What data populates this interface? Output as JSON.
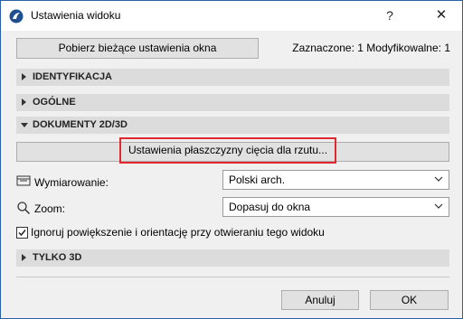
{
  "window": {
    "title": "Ustawienia widoku",
    "help_glyph": "?",
    "close_glyph": "✕"
  },
  "toolbar": {
    "fetch_label": "Pobierz bieżące ustawienia okna",
    "selection_info": "Zaznaczone: 1 Modyfikowalne: 1"
  },
  "sections": [
    {
      "label": "IDENTYFIKACJA",
      "expanded": false
    },
    {
      "label": "OGÓLNE",
      "expanded": false
    },
    {
      "label": "DOKUMENTY 2D/3D",
      "expanded": true
    },
    {
      "label": "TYLKO 3D",
      "expanded": false
    }
  ],
  "docs": {
    "cut_plane_label": "Ustawienia płaszczyzny cięcia dla rzutu...",
    "dimensioning_label": "Wymiarowanie:",
    "dimensioning_value": "Polski arch.",
    "zoom_label": "Zoom:",
    "zoom_value": "Dopasuj do okna",
    "ignore_zoom_label": "Ignoruj powiększenie i orientację przy otwieraniu tego widoku",
    "ignore_zoom_checked": true
  },
  "footer": {
    "cancel_label": "Anuluj",
    "ok_label": "OK"
  },
  "colors": {
    "highlight": "#e0282e",
    "section_bg": "#dcdcdc",
    "window_border": "#2b5fa8"
  }
}
